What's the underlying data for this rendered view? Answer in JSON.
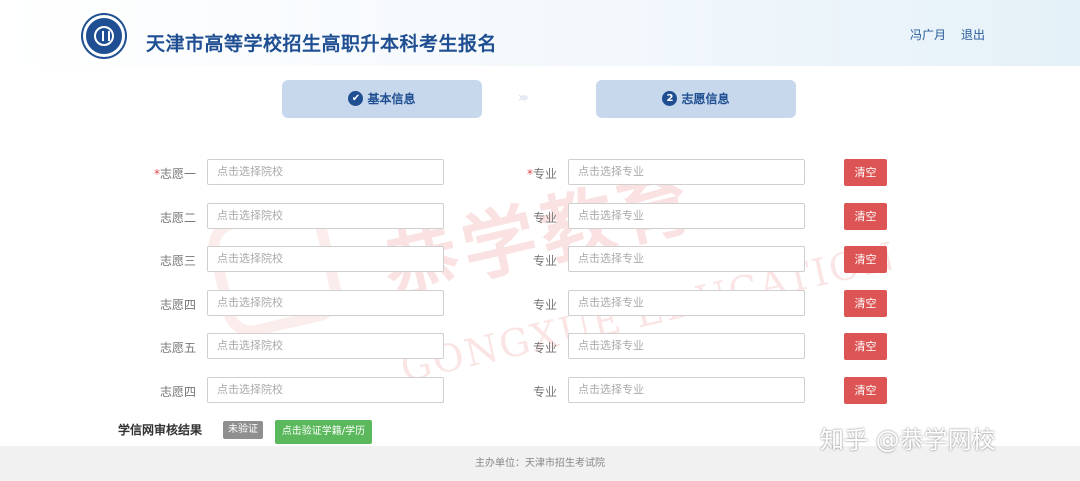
{
  "header": {
    "title": "天津市高等学校招生高职升本科考生报名",
    "user_name": "冯广月",
    "logout": "退出"
  },
  "steps": [
    {
      "label": "基本信息",
      "icon": "✔",
      "status": "done"
    },
    {
      "label": "志愿信息",
      "icon": "2",
      "status": "current"
    }
  ],
  "form": {
    "major_label": "专业",
    "clear_label": "清空",
    "rows": [
      {
        "label": "志愿一",
        "required": true,
        "school_placeholder": "点击选择院校",
        "major_placeholder": "点击选择专业"
      },
      {
        "label": "志愿二",
        "required": false,
        "school_placeholder": "点击选择院校",
        "major_placeholder": "点击选择专业"
      },
      {
        "label": "志愿三",
        "required": false,
        "school_placeholder": "点击选择院校",
        "major_placeholder": "点击选择专业"
      },
      {
        "label": "志愿四",
        "required": false,
        "school_placeholder": "点击选择院校",
        "major_placeholder": "点击选择专业"
      },
      {
        "label": "志愿五",
        "required": false,
        "school_placeholder": "点击选择院校",
        "major_placeholder": "点击选择专业"
      },
      {
        "label": "志愿四",
        "required": false,
        "school_placeholder": "点击选择院校",
        "major_placeholder": "点击选择专业"
      }
    ]
  },
  "verification": {
    "label": "学信网审核结果",
    "status": "未验证",
    "button": "点击验证学籍/学历"
  },
  "footer": {
    "text": "主办单位：天津市招生考试院"
  },
  "watermark": {
    "brand": "恭学教育",
    "brand_en": "GONGXUE EDUCATION",
    "corner": "知乎 @恭学网校"
  },
  "colors": {
    "primary": "#1f4f92",
    "step_bg": "#c8d8ec",
    "danger": "#dd5454",
    "success": "#5cb85c",
    "required": "#e04a4a"
  }
}
